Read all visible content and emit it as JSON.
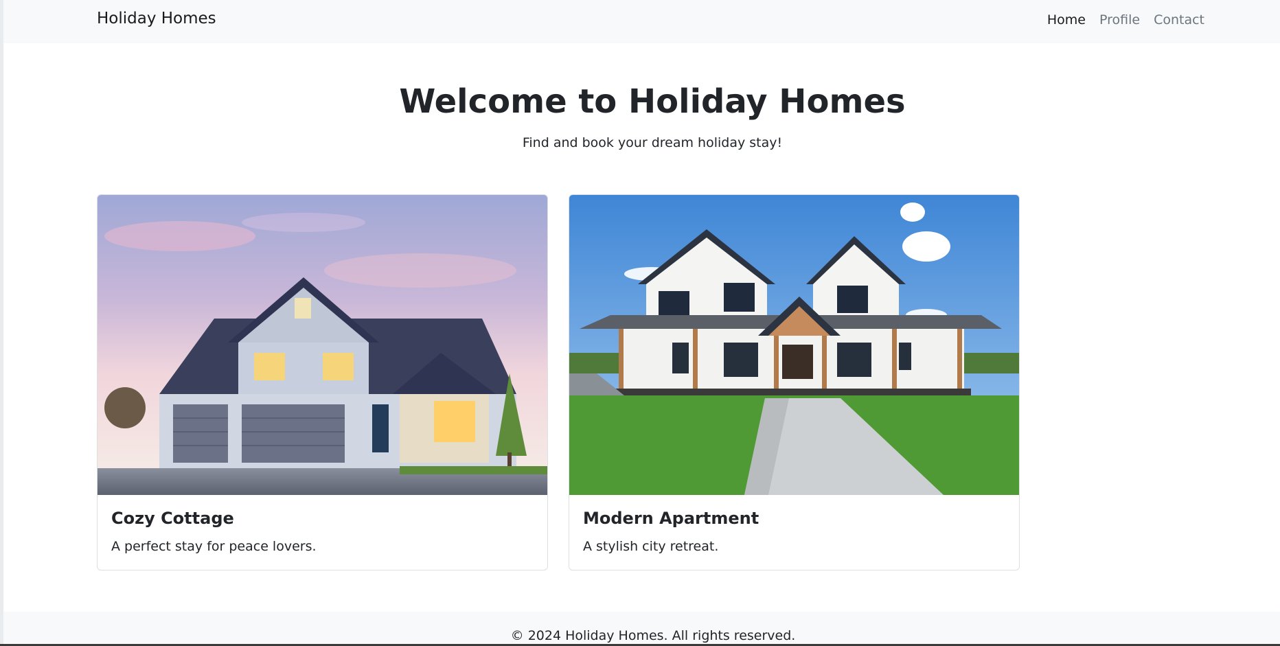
{
  "navbar": {
    "brand": "Holiday Homes",
    "links": [
      {
        "label": "Home",
        "active": true
      },
      {
        "label": "Profile",
        "active": false
      },
      {
        "label": "Contact",
        "active": false
      }
    ]
  },
  "hero": {
    "title": "Welcome to Holiday Homes",
    "subtitle": "Find and book your dream holiday stay!"
  },
  "cards": [
    {
      "title": "Cozy Cottage",
      "text": "A perfect stay for peace lovers."
    },
    {
      "title": "Modern Apartment",
      "text": "A stylish city retreat."
    }
  ],
  "footer": {
    "text": "© 2024 Holiday Homes. All rights reserved."
  }
}
